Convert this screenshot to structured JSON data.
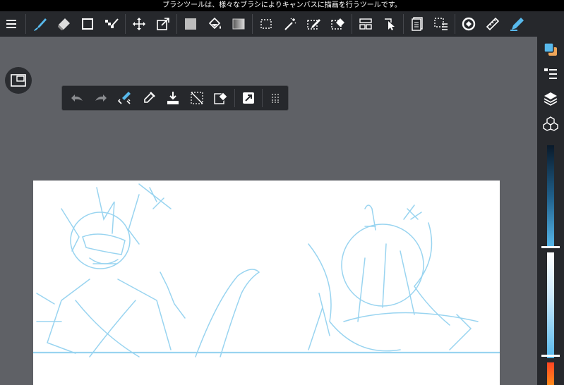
{
  "status_bar": {
    "message": "ブラシツールは、様々なブラシによりキャンバスに描画を行うツールです。"
  },
  "toolbar": {
    "items": [
      "menu-icon",
      "brush-icon",
      "eraser-icon",
      "rectangle-icon",
      "dot-eraser-icon",
      "move-icon",
      "transform-icon",
      "fill-color-icon",
      "bucket-icon",
      "gradient-icon",
      "select-icon",
      "magic-wand-icon",
      "select-pen-icon",
      "select-eraser-icon",
      "layout-icon",
      "operation-icon",
      "layer-mask-icon",
      "grid-select-icon",
      "rotate-icon",
      "ruler-icon",
      "pen-icon"
    ]
  },
  "sub_toolbar": {
    "items": [
      "undo-icon",
      "redo-icon",
      "brush-size-icon",
      "eyedropper-icon",
      "save-icon",
      "deselect-icon",
      "eraser-select-icon",
      "flip-icon",
      "grip-icon"
    ]
  },
  "colors": {
    "accent": "#58b9ec",
    "toolbar_bg": "#26282c",
    "canvas_bg": "#ffffff",
    "workspace_bg": "#5f6166",
    "sketch_line": "#8fd0ef"
  },
  "side_panel": {
    "items": [
      "color-palette-icon",
      "brush-list-icon",
      "layers-icon",
      "material-icon"
    ]
  }
}
